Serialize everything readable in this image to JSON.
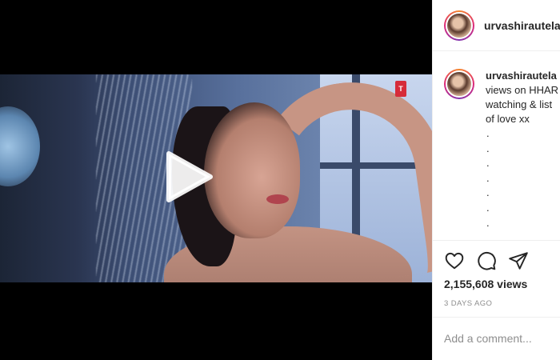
{
  "post": {
    "username": "urvashirautela",
    "caption": {
      "username": "urvashirautela",
      "lines": [
        "views on HHAR",
        "watching & list",
        "of love xx"
      ],
      "dots": [
        ".",
        ".",
        ".",
        ".",
        ".",
        ".",
        "."
      ]
    },
    "views": "2,155,608 views",
    "timestamp": "3 DAYS AGO",
    "comment_placeholder": "Add a comment..."
  },
  "icons": {
    "play": "play-icon",
    "like": "heart-icon",
    "comment": "comment-icon",
    "share": "send-icon"
  },
  "colors": {
    "text": "#262626",
    "muted": "#8e8e8e",
    "border": "#efefef",
    "play_overlay": "#ffffff"
  }
}
